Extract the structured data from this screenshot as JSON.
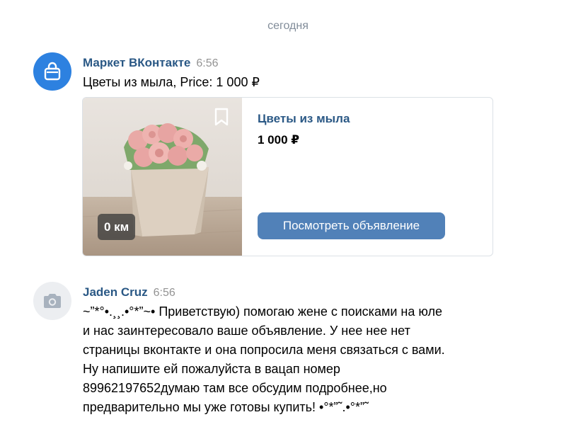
{
  "date_separator": "сегодня",
  "messages": [
    {
      "author": "Маркет ВКонтакте",
      "time": "6:56",
      "text": "Цветы из мыла, Price: 1 000 ₽",
      "avatar_icon": "shopping-bag-icon",
      "card": {
        "title": "Цветы из мыла",
        "price": "1 000 ₽",
        "distance": "0 км",
        "button": "Посмотреть объявление"
      }
    },
    {
      "author": "Jaden Cruz",
      "time": "6:56",
      "avatar_icon": "camera-icon",
      "lines": [
        "~”*°•.¸¸.•°*”~• Приветствую) помогаю жене с поисками на юле",
        "и нас заинтересовало ваше объявление. У нее нее нет",
        "страницы вконтакте и она попросила меня связаться с вами.",
        "Ну напишите ей пожалуйста в вацап номер",
        "89962197652думаю там все обсудим подробнее,но",
        "предварительно мы уже готовы купить! •°*”˜.•°*”˜"
      ]
    }
  ],
  "colors": {
    "link": "#2a5885",
    "button": "#5181b8",
    "avatar_market": "#2d81e0",
    "avatar_placeholder": "#eceef1"
  }
}
